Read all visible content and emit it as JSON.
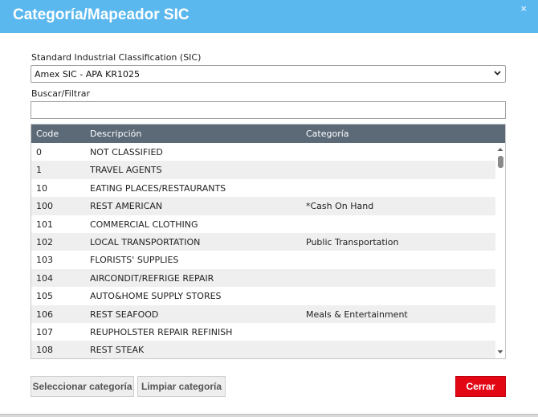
{
  "dialog": {
    "title": "Categoría/Mapeador SIC",
    "close_glyph": "×"
  },
  "sic": {
    "label": "Standard Industrial Classification (SIC)",
    "selected": "Amex SIC - APA KR1025"
  },
  "filter": {
    "label": "Buscar/Filtrar",
    "value": ""
  },
  "table": {
    "columns": {
      "code": "Code",
      "description": "Descripción",
      "category": "Categoría"
    },
    "rows": [
      {
        "code": "0",
        "description": "NOT CLASSIFIED",
        "category": ""
      },
      {
        "code": "1",
        "description": "TRAVEL AGENTS",
        "category": ""
      },
      {
        "code": "10",
        "description": "EATING PLACES/RESTAURANTS",
        "category": ""
      },
      {
        "code": "100",
        "description": "REST AMERICAN",
        "category": "*Cash On Hand"
      },
      {
        "code": "101",
        "description": "COMMERCIAL CLOTHING",
        "category": ""
      },
      {
        "code": "102",
        "description": "LOCAL TRANSPORTATION",
        "category": "Public Transportation"
      },
      {
        "code": "103",
        "description": "FLORISTS' SUPPLIES",
        "category": ""
      },
      {
        "code": "104",
        "description": "AIRCONDIT/REFRIGE REPAIR",
        "category": ""
      },
      {
        "code": "105",
        "description": "AUTO&HOME SUPPLY STORES",
        "category": ""
      },
      {
        "code": "106",
        "description": "REST SEAFOOD",
        "category": "Meals & Entertainment"
      },
      {
        "code": "107",
        "description": "REUPHOLSTER REPAIR REFINISH",
        "category": ""
      },
      {
        "code": "108",
        "description": "REST STEAK",
        "category": ""
      }
    ]
  },
  "buttons": {
    "select_category": "Seleccionar categoría",
    "clear_category": "Limpiar categoría",
    "close": "Cerrar"
  },
  "colors": {
    "title_bar": "#5bb8ef",
    "grid_header": "#5c6a78",
    "close_button": "#e30613"
  },
  "icons": {
    "close": "close-icon",
    "dropdown": "chevron-down-icon",
    "scroll_up": "scroll-up-arrow-icon",
    "scroll_down": "scroll-down-arrow-icon"
  }
}
